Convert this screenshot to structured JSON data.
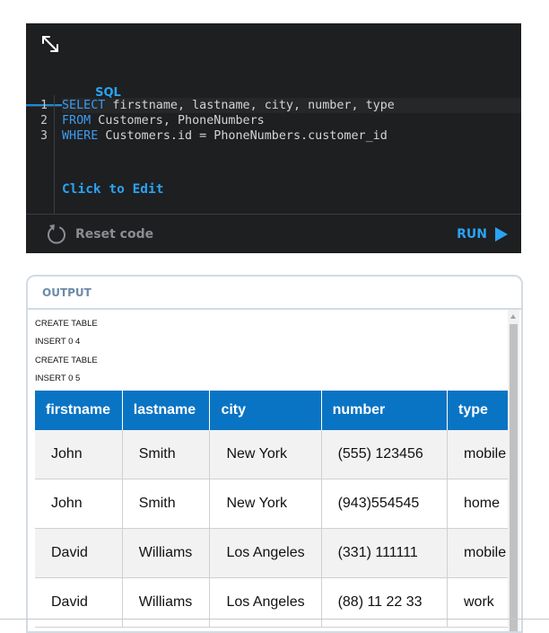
{
  "editor": {
    "tab_label": "SQL",
    "line_numbers": [
      "1",
      "2",
      "3"
    ],
    "code": [
      {
        "kw": "SELECT",
        "rest": " firstname, lastname, city, number, type"
      },
      {
        "kw": "FROM",
        "rest": " Customers, PhoneNumbers"
      },
      {
        "kw": "WHERE",
        "rest": " Customers.id = PhoneNumbers.customer_id"
      }
    ],
    "click_to_edit": "Click to Edit",
    "reset_label": "Reset code",
    "run_label": "RUN"
  },
  "colors": {
    "editor_bg": "#1e1f21",
    "accent": "#29a3f2",
    "table_header": "#0a74c4"
  },
  "output": {
    "title": "OUTPUT",
    "messages": [
      "CREATE TABLE",
      "INSERT 0 4",
      "CREATE TABLE",
      "INSERT 0 5"
    ],
    "table": {
      "columns": [
        "firstname",
        "lastname",
        "city",
        "number",
        "type"
      ],
      "rows": [
        [
          "John",
          "Smith",
          "New York",
          "(555) 123456",
          "mobile"
        ],
        [
          "John",
          "Smith",
          "New York",
          "(943)554545",
          "home"
        ],
        [
          "David",
          "Williams",
          "Los Angeles",
          "(331) 111111",
          "mobile"
        ],
        [
          "David",
          "Williams",
          "Los Angeles",
          "(88) 11 22 33",
          "work"
        ]
      ]
    }
  }
}
